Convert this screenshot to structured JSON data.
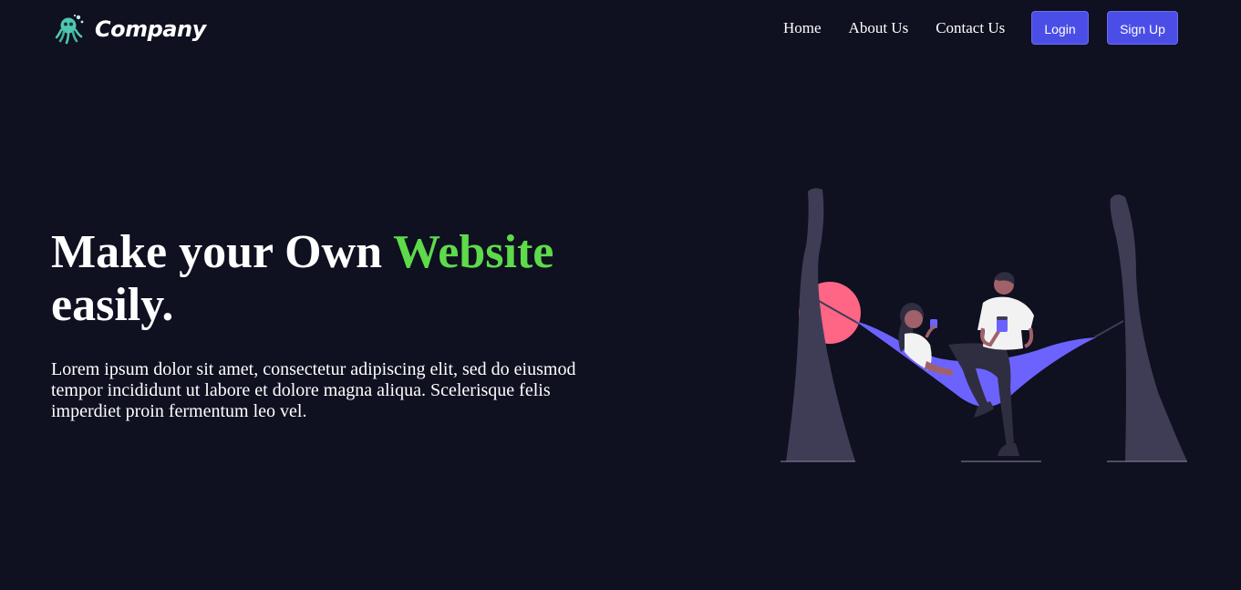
{
  "brand": {
    "name": "Company",
    "logo_icon": "octopus-logo-icon"
  },
  "nav": {
    "links": [
      "Home",
      "About Us",
      "Contact Us"
    ],
    "login_label": "Login",
    "signup_label": "Sign Up"
  },
  "hero": {
    "title_start": "Make your Own ",
    "title_accent": "Website",
    "title_end": " easily.",
    "description": "Lorem ipsum dolor sit amet, consectetur adipiscing elit, sed do eiusmod tempor incididunt ut labore et dolore magna aliqua. Scelerisque felis imperdiet proin fermentum leo vel.",
    "illustration": "hammock-couple-illustration"
  },
  "colors": {
    "background": "#0f1020",
    "accent_green": "#5ddb4b",
    "button_blue": "#4b4ee6",
    "hammock_purple": "#6c63ff",
    "sun_pink": "#ff6584",
    "tree_gray": "#3f3d56"
  }
}
